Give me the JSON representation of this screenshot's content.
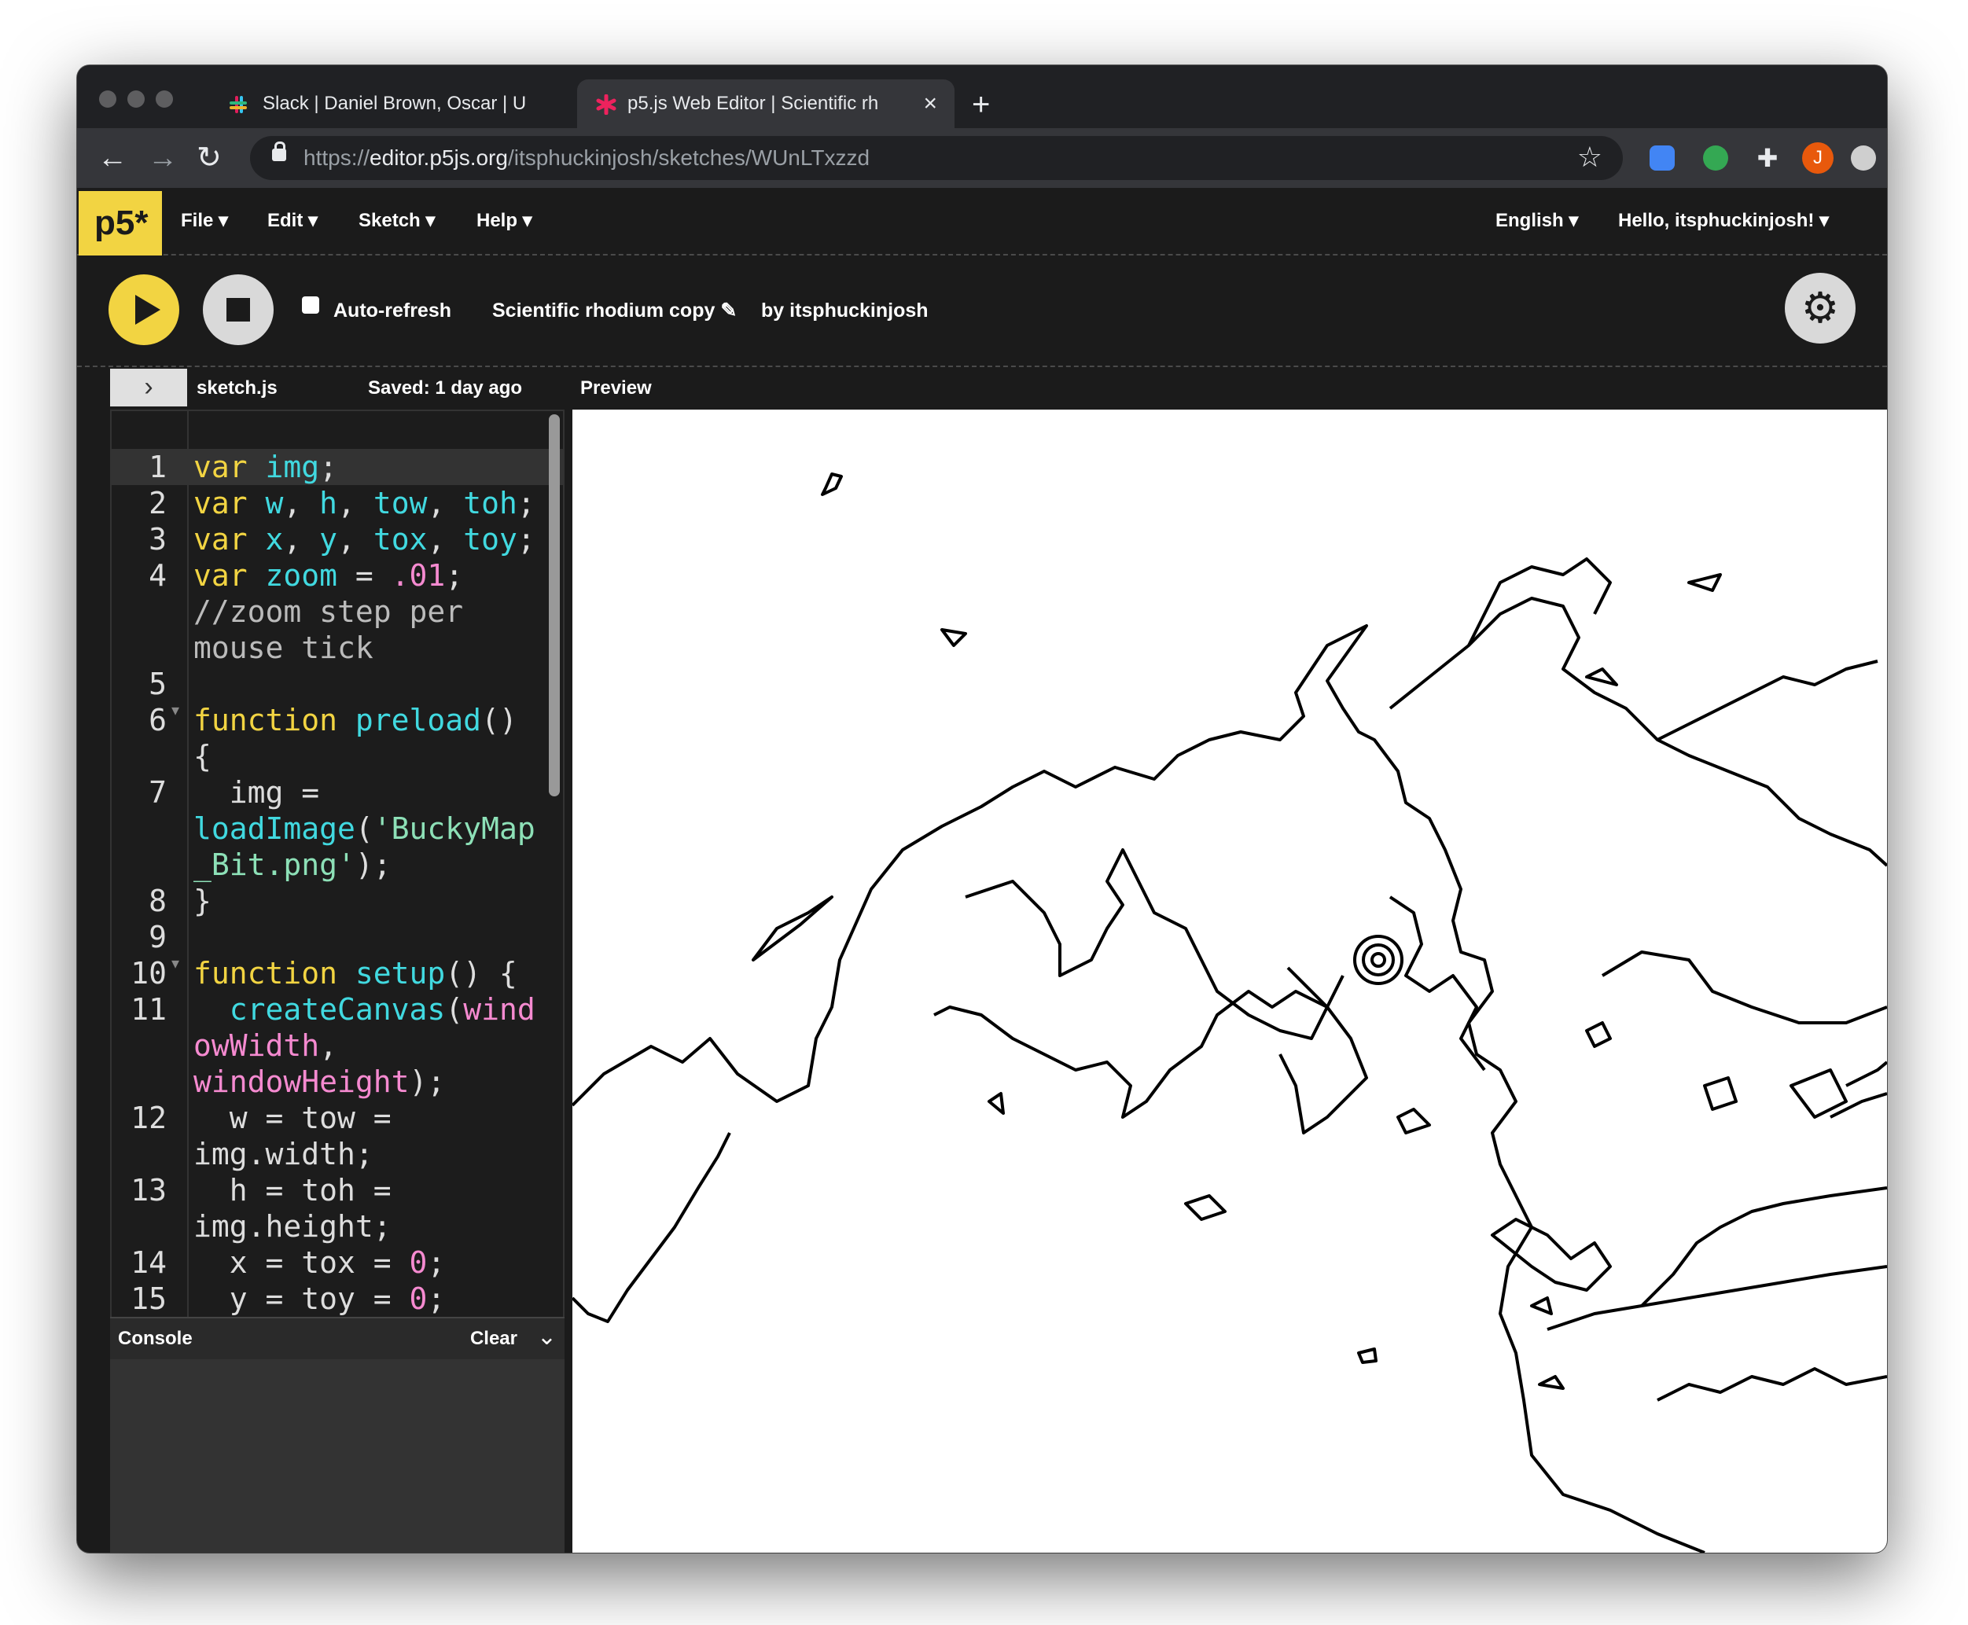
{
  "browser": {
    "tabs": [
      {
        "title": "Slack | Daniel Brown, Oscar | U",
        "active": false,
        "favicon": "slack-icon"
      },
      {
        "title": "p5.js Web Editor | Scientific rh",
        "active": true,
        "favicon": "p5-asterisk-icon"
      }
    ],
    "close_glyph": "×",
    "new_tab_glyph": "+",
    "url_scheme": "https://",
    "url_host": "editor.p5js.org",
    "url_path": "/itsphuckinjosh/sketches/WUnLTxzzd",
    "avatar_letter": "J"
  },
  "app": {
    "logo": "p5*",
    "menu": [
      "File ▾",
      "Edit ▾",
      "Sketch ▾",
      "Help ▾"
    ],
    "language": "English ▾",
    "user": "Hello, itsphuckinjosh! ▾",
    "auto_refresh_label": "Auto-refresh",
    "sketch_name": "Scientific rhodium copy ✎",
    "author": "by itsphuckinjosh",
    "file_name": "sketch.js",
    "saved": "Saved: 1 day ago",
    "preview_label": "Preview",
    "console_title": "Console",
    "console_clear": "Clear"
  },
  "code": {
    "line_numbers": [
      "1",
      "2",
      "3",
      "4",
      "",
      "",
      "5",
      "6",
      "",
      "7",
      "",
      "",
      "8",
      "9",
      "10",
      "11",
      "",
      "",
      "12",
      "",
      "13",
      "",
      "14",
      "15"
    ]
  },
  "colors": {
    "accent": "#f2d442",
    "background": "#1b1b1b"
  }
}
